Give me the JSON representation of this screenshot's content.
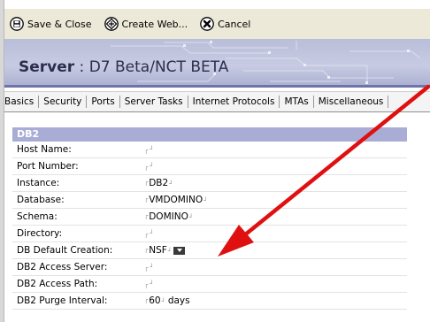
{
  "toolbar": {
    "save_close": "Save & Close",
    "create_web": "Create Web...",
    "cancel": "Cancel"
  },
  "banner": {
    "label": "Server",
    "separator": " : ",
    "server_name": "D7 Beta/NCT BETA"
  },
  "tabs": [
    "Basics",
    "Security",
    "Ports",
    "Server Tasks",
    "Internet Protocols",
    "MTAs",
    "Miscellaneous"
  ],
  "section": {
    "title": "DB2"
  },
  "fields": [
    {
      "label": "Host Name:",
      "value": ""
    },
    {
      "label": "Port Number:",
      "value": ""
    },
    {
      "label": "Instance:",
      "value": "DB2"
    },
    {
      "label": "Database:",
      "value": "VMDOMINO"
    },
    {
      "label": "Schema:",
      "value": "DOMINO"
    },
    {
      "label": "Directory:",
      "value": ""
    },
    {
      "label": "DB Default Creation:",
      "value": "NSF",
      "dropdown": true
    },
    {
      "label": "DB2 Access Server:",
      "value": ""
    },
    {
      "label": "DB2 Access Path:",
      "value": ""
    },
    {
      "label": "DB2 Purge Interval:",
      "value": "60",
      "suffix": "days"
    }
  ],
  "colors": {
    "annotation_arrow": "#e01010",
    "section_header": "#a9acd4",
    "toolbar": "#ece9d8"
  },
  "icons": {
    "save_close": "floppy-disk-icon",
    "create_web": "diamond-arrows-icon",
    "cancel": "x-circle-icon"
  }
}
